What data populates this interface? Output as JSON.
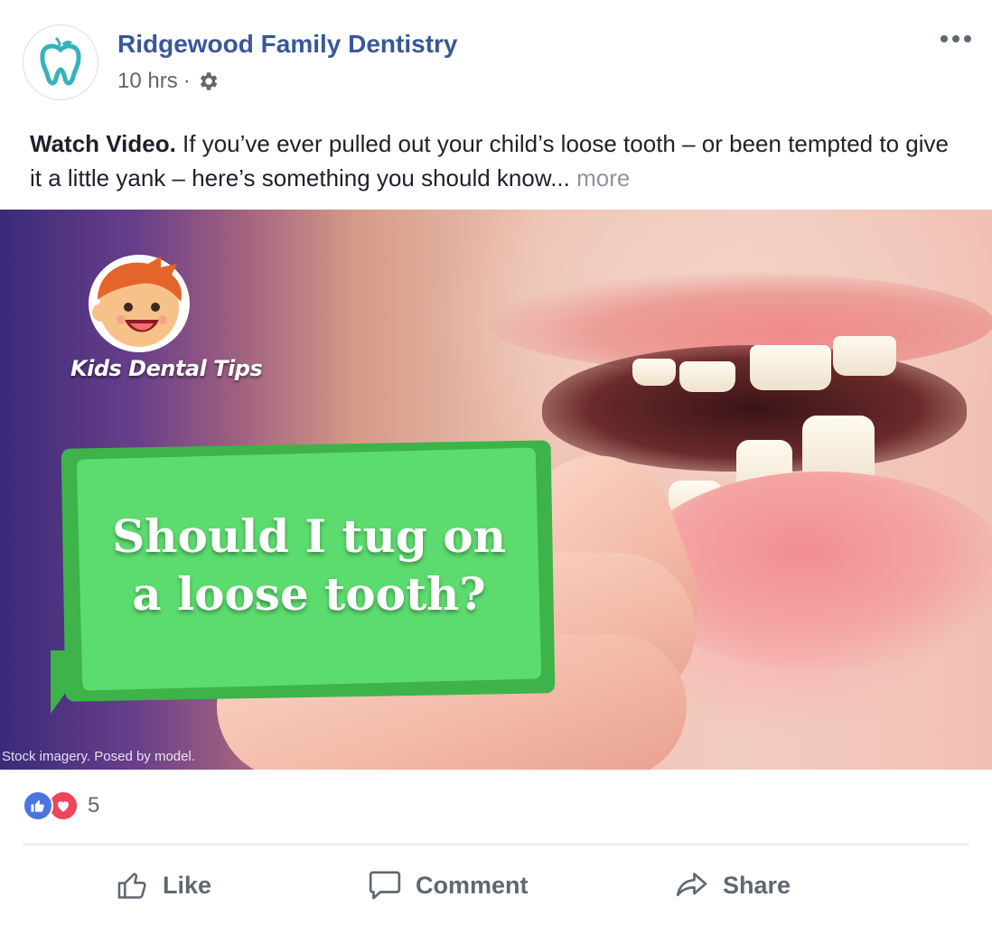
{
  "post": {
    "page_name": "Ridgewood Family Dentistry",
    "timestamp": "10 hrs",
    "separator": "·",
    "privacy_icon": "gear-icon",
    "menu_icon": "more-dots-icon"
  },
  "caption": {
    "bold": "Watch Video.",
    "text": " If you’ve ever pulled out your child’s loose tooth – or been tempted to give it a little yank – here’s something you should know...",
    "more": "more"
  },
  "media": {
    "logo_label": "Kids Dental Tips",
    "bubble_line1": "Should I tug on",
    "bubble_line2": "a loose tooth?",
    "disclaimer": "Stock imagery. Posed by model."
  },
  "reactions": {
    "types": [
      "like-reaction-icon",
      "love-reaction-icon"
    ],
    "count": "5"
  },
  "actions": {
    "like": "Like",
    "comment": "Comment",
    "share": "Share"
  },
  "colors": {
    "page_name": "#385898",
    "meta": "#606770",
    "bubble_green": "#5cdb6e",
    "like_blue": "#4a76e0",
    "love_red": "#f0445a"
  }
}
